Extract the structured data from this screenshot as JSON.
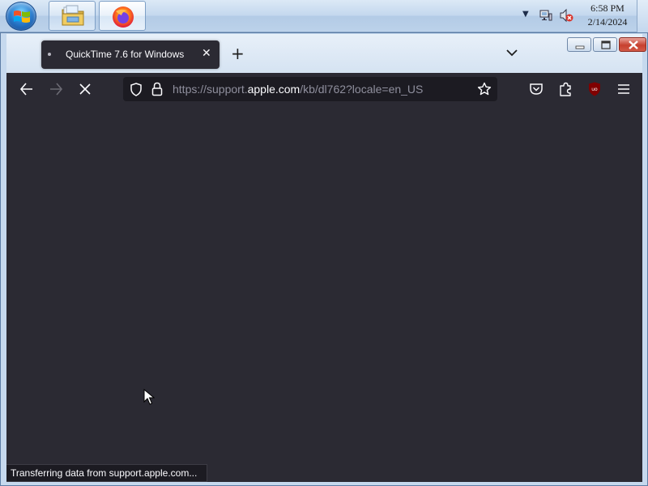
{
  "taskbar": {
    "pinned_apps": [
      {
        "name": "Windows Explorer",
        "icon": "folder-icon"
      },
      {
        "name": "Firefox",
        "icon": "firefox-icon"
      }
    ],
    "clock": {
      "time": "6:58 PM",
      "date": "2/14/2024"
    },
    "tray_icons": [
      "tray-overflow-icon",
      "network-icon",
      "volume-muted-icon"
    ]
  },
  "browser": {
    "tab": {
      "title": "QuickTime 7.6 for Windows",
      "loading": true
    },
    "url": {
      "prefix": "https://support.",
      "host": "apple.com",
      "path": "/kb/dl762?locale=en_US"
    },
    "status_text": "Transferring data from support.apple.com...",
    "theme": {
      "toolbar": "#2b2a33",
      "urlbar": "#1c1b22",
      "text": "#fbfbfe",
      "muted_text": "#8f8f9d"
    }
  }
}
